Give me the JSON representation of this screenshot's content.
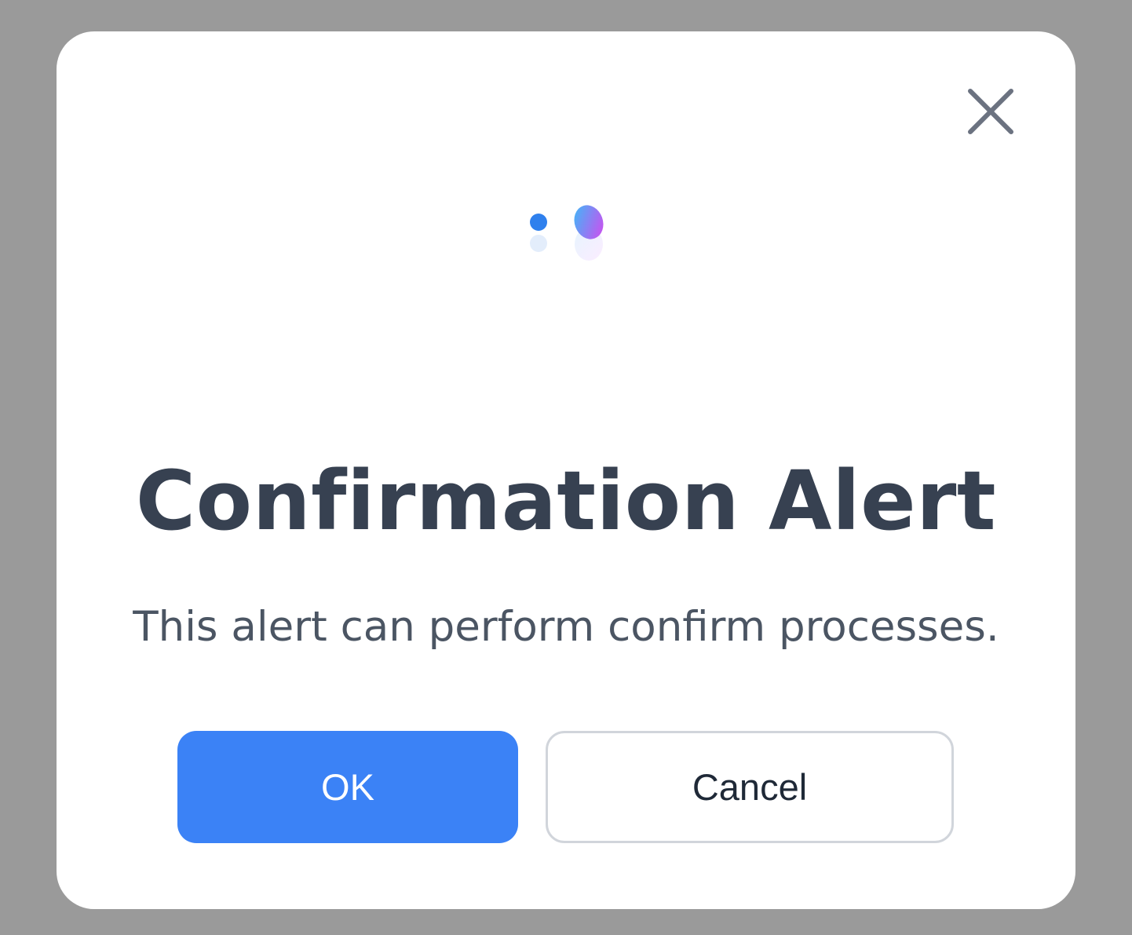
{
  "dialog": {
    "title": "Confirmation Alert",
    "message": "This alert can perform confirm processes.",
    "ok_label": "OK",
    "cancel_label": "Cancel",
    "close_icon": "close-icon",
    "logo_icon": "animated-dots-logo-icon"
  },
  "colors": {
    "overlay": "#9a9a9a",
    "dialog_background": "#ffffff",
    "title": "#374151",
    "message": "#4b5563",
    "primary_button": "#3b82f6",
    "primary_button_text": "#ffffff",
    "secondary_button_border": "#d1d5db",
    "secondary_button_text": "#1f2937",
    "close_icon": "#6b7280",
    "logo_dot": "#2f80ed",
    "logo_gradient_start": "#38bdf8",
    "logo_gradient_end": "#d946ef"
  }
}
